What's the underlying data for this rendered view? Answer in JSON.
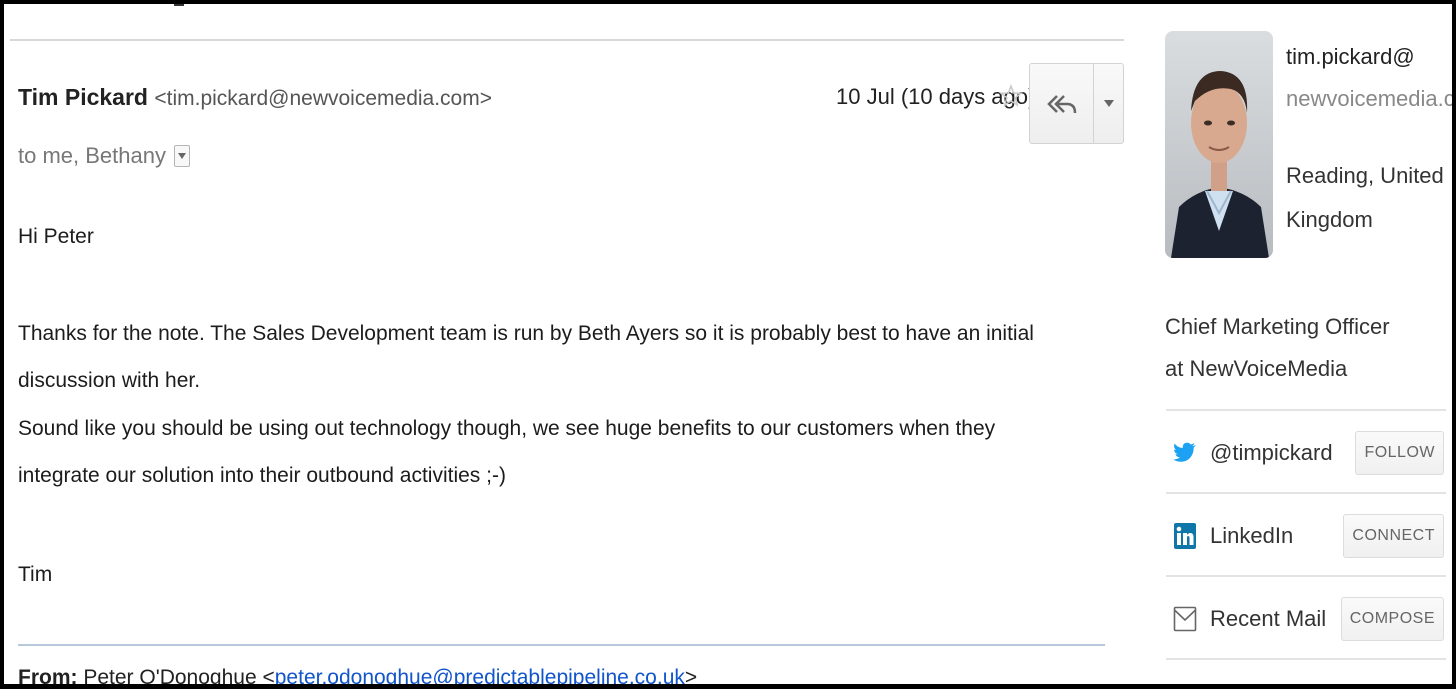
{
  "message": {
    "sender_name": "Tim Pickard",
    "sender_email": "<tim.pickard@newvoicemedia.com>",
    "recipients": "to me, Bethany",
    "date": "10 Jul (10 days ago)",
    "icons": {
      "star": "star-outline-icon",
      "reply": "reply-all-icon",
      "more": "caret-down-icon"
    }
  },
  "body": {
    "greeting": "Hi Peter",
    "paragraph_1": "Thanks for the note. The Sales Development team is run by Beth Ayers so it is probably best to have an initial discussion with her.",
    "paragraph_2": "Sound like you should be using out technology though, we see huge benefits to our customers when they integrate our solution into their outbound activities ;-)",
    "signature": "Tim"
  },
  "quoted": {
    "from_label": "From:",
    "from_name": "Peter O'Donoghue",
    "from_email": "peter.odonoghue@predictablepipeline.co.uk",
    "lt": "<",
    "gt": ">"
  },
  "contact_card": {
    "email_user": "tim.pickard@",
    "email_domain": "newvoicemedia.com",
    "location": "Reading, United Kingdom",
    "title": "Chief Marketing Officer at NewVoiceMedia",
    "social": [
      {
        "icon": "twitter-icon",
        "label": "@timpickard",
        "button": "FOLLOW"
      },
      {
        "icon": "linkedin-icon",
        "label": "LinkedIn",
        "button": "CONNECT"
      },
      {
        "icon": "mail-icon",
        "label": "Recent Mail",
        "button": "COMPOSE"
      }
    ]
  },
  "colors": {
    "link": "#1155cc",
    "twitter": "#1da1f2",
    "linkedin": "#0e76a8",
    "quote_rule": "#b9c9dd"
  }
}
